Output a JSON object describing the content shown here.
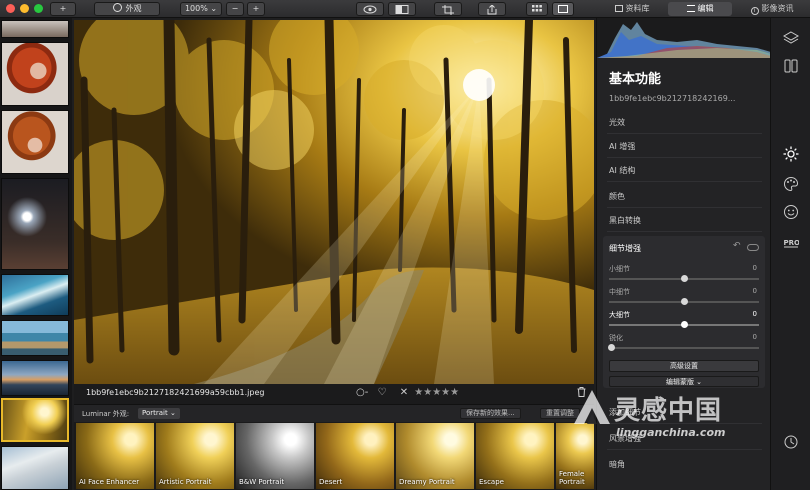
{
  "toolbar": {
    "add_label": "+",
    "looks_label": "外观",
    "zoom_value": "100%",
    "zoom_out": "−",
    "zoom_in": "+",
    "tabs": [
      {
        "label": "资料库",
        "icon": "library-icon"
      },
      {
        "label": "编辑",
        "icon": "sliders-icon",
        "active": true
      },
      {
        "label": "影像资讯",
        "icon": "info-icon"
      }
    ]
  },
  "filmstrip": {
    "thumbnails": [
      {
        "name": "portrait-woman-1"
      },
      {
        "name": "portrait-woman-2"
      },
      {
        "name": "portrait-woman-3"
      },
      {
        "name": "stage-lights"
      },
      {
        "name": "ocean-wave"
      },
      {
        "name": "coastal-rocks"
      },
      {
        "name": "beach-sunset"
      },
      {
        "name": "autumn-forest",
        "selected": true
      },
      {
        "name": "sand-dunes"
      }
    ]
  },
  "info_strip": {
    "filename": "1bb9fe1ebc9b2127182421699a59cbb1.jpeg",
    "rating_max": 5,
    "rating_stars": "★★★★★",
    "circle_label": "○-",
    "heart": "♡",
    "reject": "✕",
    "trash": "🗑"
  },
  "preset_bar": {
    "label": "Luminar 外观:",
    "category": "Portrait ⌄",
    "save_label": "保存新的效果...",
    "reset_label": "重置调整"
  },
  "presets": [
    {
      "name": "AI Face Enhancer"
    },
    {
      "name": "Artistic Portrait"
    },
    {
      "name": "B&W Portrait"
    },
    {
      "name": "Desert"
    },
    {
      "name": "Dreamy Portrait"
    },
    {
      "name": "Escape"
    },
    {
      "name": "Female Portrait"
    }
  ],
  "panel": {
    "title": "基本功能",
    "hash": "1bb9fe1ebc9b212718242169...",
    "sections": [
      "光效",
      "AI 增强",
      "AI 结构",
      "颜色",
      "黑白转换"
    ],
    "detail": {
      "title": "细节增强",
      "sliders": [
        {
          "label": "小细节",
          "value": "0"
        },
        {
          "label": "中细节",
          "value": "0"
        },
        {
          "label": "大细节",
          "value": "0",
          "highlight": true
        },
        {
          "label": "锐化",
          "value": "0"
        }
      ],
      "advanced_label": "高级设置",
      "mask_label": "编辑蒙版 ⌄"
    },
    "lower_sections": [
      "添加细节",
      "风景增强",
      "暗角"
    ]
  },
  "watermark": {
    "chinese": "灵感中国",
    "url": "lingganchina.com"
  },
  "colors": {
    "accent": "#e8b92a",
    "panel_bg": "#232325",
    "toolbar_bg": "#2c2c2e"
  }
}
